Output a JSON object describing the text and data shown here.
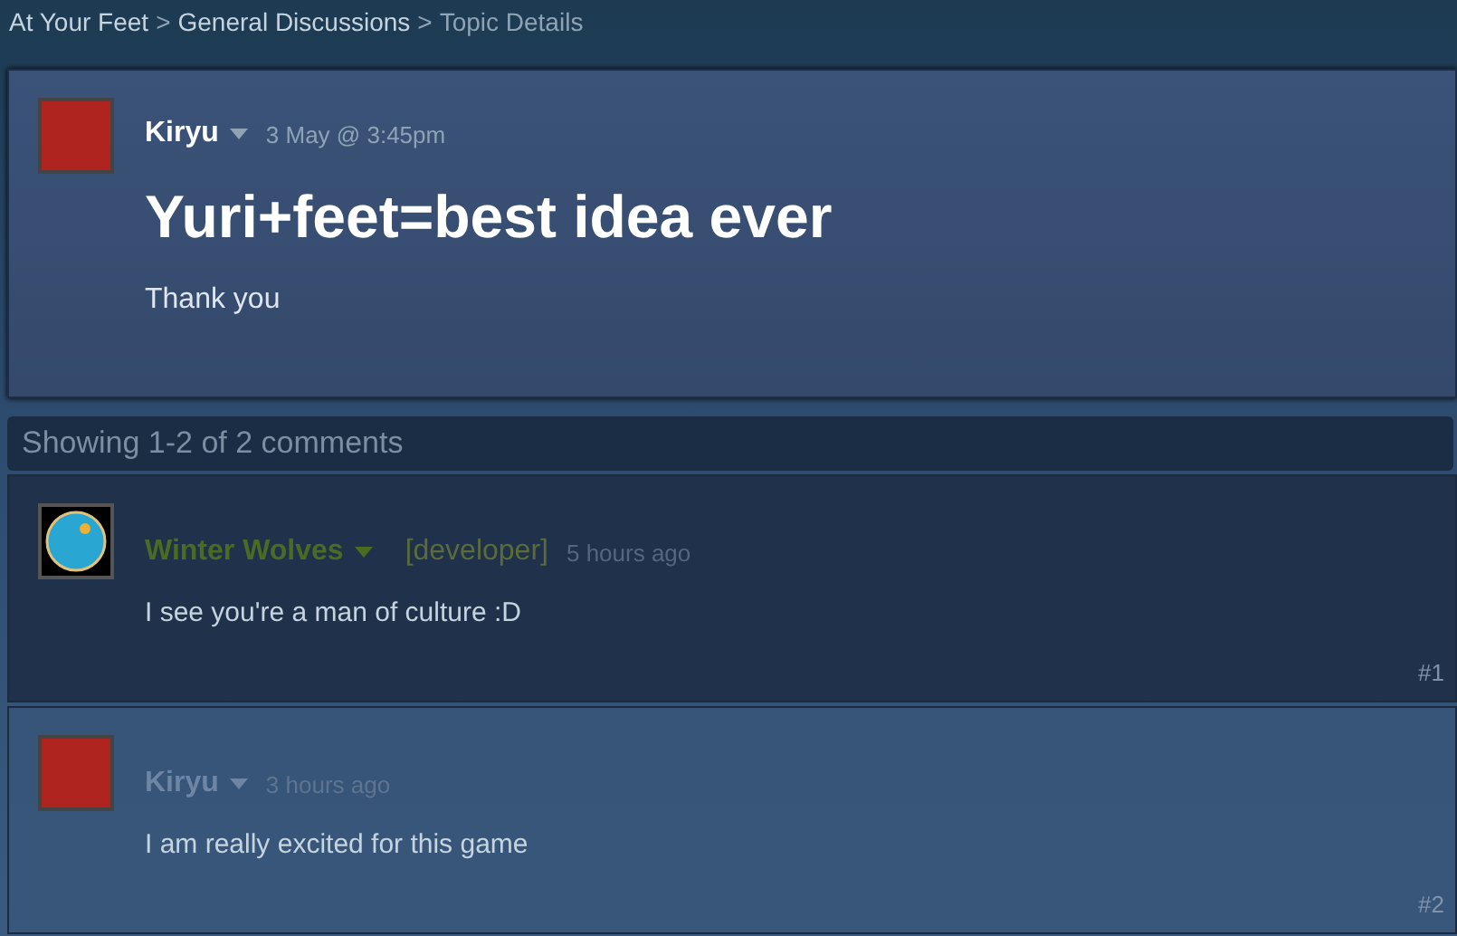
{
  "breadcrumb": [
    {
      "label": "At Your Feet",
      "current": false
    },
    {
      "label": "General Discussions",
      "current": false
    },
    {
      "label": "Topic Details",
      "current": true
    }
  ],
  "separator": ">",
  "topic": {
    "author": "Kiryu",
    "time": "3 May @ 3:45pm",
    "title": "Yuri+feet=best idea ever",
    "body": "Thank you"
  },
  "comments_header": "Showing 1-2 of 2 comments",
  "comments": [
    {
      "kind": "developer",
      "author": "Winter Wolves",
      "tag": "[developer]",
      "time": "5 hours ago",
      "text": "I see you're a man of culture :D",
      "number": "#1"
    },
    {
      "kind": "user",
      "author": "Kiryu",
      "time": "3 hours ago",
      "text": "I am really excited for this game",
      "number": "#2"
    }
  ]
}
